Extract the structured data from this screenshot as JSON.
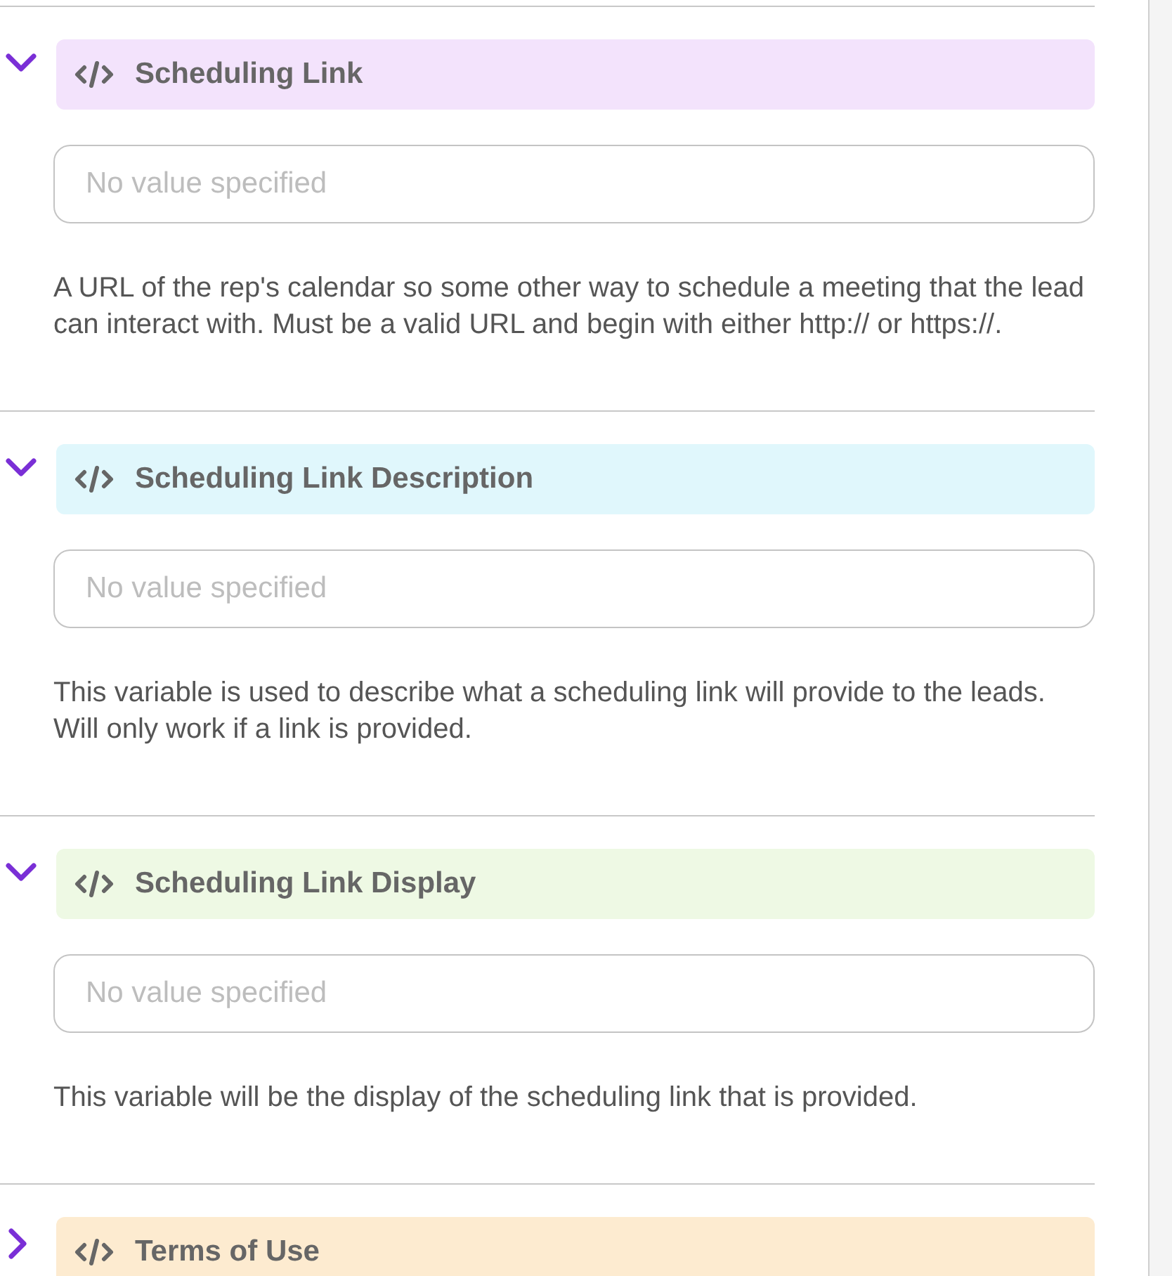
{
  "sections": [
    {
      "title": "Scheduling Link",
      "color": "#f3e3fc",
      "expanded": true,
      "placeholder": "No value specified",
      "description": "A URL of the rep's calendar so some other way to schedule a meeting that the lead can interact with. Must be a valid URL and begin with either http:// or https://."
    },
    {
      "title": "Scheduling Link Description",
      "color": "#e0f7fc",
      "expanded": true,
      "placeholder": "No value specified",
      "description": "This variable is used to describe what a scheduling link will provide to the leads. Will only work if a link is provided."
    },
    {
      "title": "Scheduling Link Display",
      "color": "#eef9e4",
      "expanded": true,
      "placeholder": "No value specified",
      "description": "This variable will be the display of the scheduling link that is provided."
    },
    {
      "title": "Terms of Use",
      "color": "#fdebd0",
      "expanded": false
    }
  ]
}
